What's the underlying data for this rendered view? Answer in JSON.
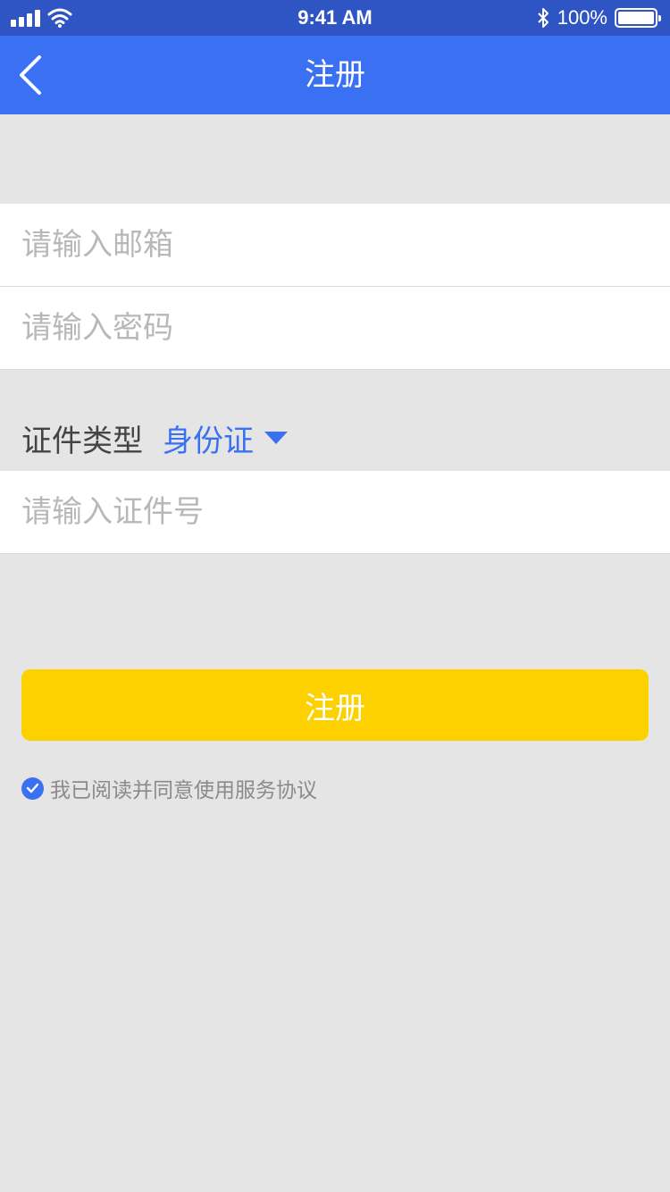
{
  "status_bar": {
    "time": "9:41 AM",
    "battery": "100%",
    "icons": [
      "signal-icon",
      "wifi-icon",
      "bluetooth-icon",
      "battery-icon"
    ],
    "battery_level": 1.0
  },
  "nav": {
    "title": "注册",
    "back_icon": "chevron-left-icon"
  },
  "form": {
    "email_placeholder": "请输入邮箱",
    "password_placeholder": "请输入密码",
    "id_type_label": "证件类型",
    "id_type_value": "身份证",
    "id_number_placeholder": "请输入证件号",
    "submit_label": "注册"
  },
  "agreement": {
    "text": "我已阅读并同意使用服务协议",
    "checked": true
  },
  "colors": {
    "status_bar": "#2f55c4",
    "nav_bar": "#3a70f2",
    "accent": "#3a70f2",
    "button": "#fdd000",
    "background": "#e5e5e5"
  }
}
